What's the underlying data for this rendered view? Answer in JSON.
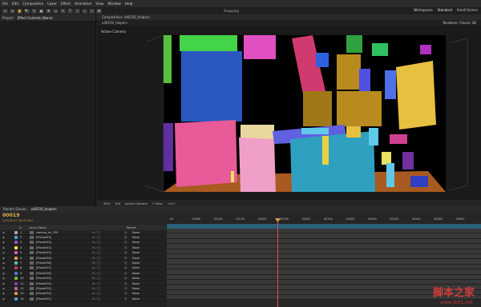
{
  "menu": [
    "File",
    "Edit",
    "Composition",
    "Layer",
    "Effect",
    "Animation",
    "View",
    "Window",
    "Help"
  ],
  "toolbar": {
    "snapping": "Snapping",
    "workspaces": [
      "Workspaces",
      "Standard",
      "Small Screen"
    ]
  },
  "left_panel": {
    "tabs": [
      "Project",
      "Effect Controls (None)"
    ]
  },
  "viewer": {
    "tab": "Composition: x46150_helpers",
    "subtab": "x46150_helpers",
    "camera_label": "Active Camera",
    "renderer_label": "Renderer:",
    "renderer_value": "Classic 3D",
    "footer": {
      "zoom": "50%",
      "res": "Full",
      "camera": "Active Camera",
      "views": "1 View",
      "offset": "+0.0"
    }
  },
  "timeline": {
    "tabs": [
      "Render Queue",
      "x46150_helpers"
    ],
    "timecode": "00019",
    "fps": "0:00:00:19 (30.00 fps)",
    "columns": [
      "#",
      "Layer Name",
      "Parent"
    ],
    "ruler": [
      "00",
      "00050",
      "00100",
      "00150",
      "00200",
      "00250",
      "00300",
      "00350",
      "00400",
      "00450",
      "00500",
      "00550",
      "00600",
      "00650"
    ],
    "layers": [
      {
        "n": "1",
        "name": "camera_sh_230",
        "color": "#aaaaaa",
        "parent": "None"
      },
      {
        "n": "2",
        "name": "[Plane043]",
        "color": "#4ba3d8",
        "parent": "None"
      },
      {
        "n": "3",
        "name": "[Plane042]",
        "color": "#9a56c7",
        "parent": "None"
      },
      {
        "n": "4",
        "name": "[Plane041]",
        "color": "#e8e04a",
        "parent": "None"
      },
      {
        "n": "5",
        "name": "[Plane040]",
        "color": "#e05ab0",
        "parent": "None"
      },
      {
        "n": "6",
        "name": "[Plane039]",
        "color": "#e0a040",
        "parent": "None"
      },
      {
        "n": "7",
        "name": "[Plane038]",
        "color": "#50c0c0",
        "parent": "None"
      },
      {
        "n": "8",
        "name": "[Plane037]",
        "color": "#c04040",
        "parent": "None"
      },
      {
        "n": "9",
        "name": "[Plane036]",
        "color": "#5070e0",
        "parent": "None"
      },
      {
        "n": "10",
        "name": "[Plane035]",
        "color": "#60c050",
        "parent": "None"
      },
      {
        "n": "11",
        "name": "[Plane034]",
        "color": "#8040a0",
        "parent": "None"
      },
      {
        "n": "12",
        "name": "[Plane033]",
        "color": "#d06090",
        "parent": "None"
      },
      {
        "n": "13",
        "name": "[Plane032]",
        "color": "#e09050",
        "parent": "None"
      },
      {
        "n": "14",
        "name": "[Plane031]",
        "color": "#50a0e0",
        "parent": "None"
      }
    ]
  },
  "watermark": {
    "title": "脚本之家",
    "url": "www.jb51.net"
  }
}
